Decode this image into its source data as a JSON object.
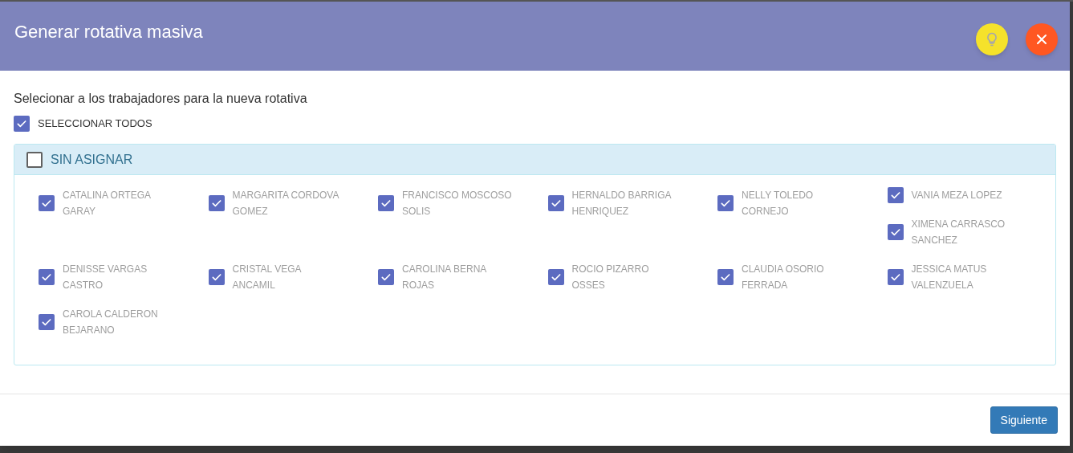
{
  "dialog": {
    "title": "Generar rotativa masiva"
  },
  "instruction": "Selecionar a los trabajadores para la nueva rotativa",
  "select_all": {
    "label": "SELECCIONAR TODOS",
    "checked": true
  },
  "group": {
    "label": "SIN ASIGNAR",
    "checked": false,
    "rows": [
      {
        "cells": [
          {
            "workers": [
              {
                "name": "CATALINA ORTEGA GARAY",
                "checked": true
              }
            ]
          },
          {
            "workers": [
              {
                "name": "MARGARITA CORDOVA GOMEZ",
                "checked": true
              }
            ]
          },
          {
            "workers": [
              {
                "name": "FRANCISCO MOSCOSO SOLIS",
                "checked": true
              }
            ]
          },
          {
            "workers": [
              {
                "name": "HERNALDO BARRIGA HENRIQUEZ",
                "checked": true
              }
            ]
          },
          {
            "workers": [
              {
                "name": "NELLY TOLEDO CORNEJO",
                "checked": true
              }
            ]
          },
          {
            "workers": [
              {
                "name": "VANIA MEZA LOPEZ",
                "checked": true
              },
              {
                "name": "XIMENA CARRASCO SANCHEZ",
                "checked": true
              }
            ]
          }
        ]
      },
      {
        "cells": [
          {
            "workers": [
              {
                "name": "DENISSE VARGAS CASTRO",
                "checked": true
              }
            ]
          },
          {
            "workers": [
              {
                "name": "CRISTAL VEGA ANCAMIL",
                "checked": true
              }
            ]
          },
          {
            "workers": [
              {
                "name": "CAROLINA BERNA ROJAS",
                "checked": true
              }
            ]
          },
          {
            "workers": [
              {
                "name": "ROCIO PIZARRO OSSES",
                "checked": true
              }
            ]
          },
          {
            "workers": [
              {
                "name": "CLAUDIA OSORIO FERRADA",
                "checked": true
              }
            ]
          },
          {
            "workers": [
              {
                "name": "JESSICA MATUS VALENZUELA",
                "checked": true
              }
            ]
          }
        ]
      },
      {
        "cells": [
          {
            "workers": [
              {
                "name": "CAROLA CALDERON BEJARANO",
                "checked": true
              }
            ]
          }
        ]
      }
    ]
  },
  "footer": {
    "next_button": "Siguiente"
  }
}
